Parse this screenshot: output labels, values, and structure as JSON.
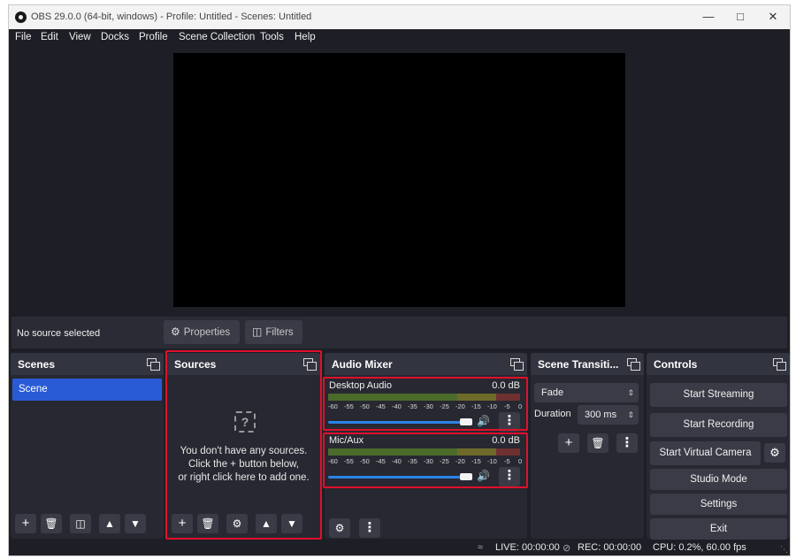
{
  "window": {
    "title": "OBS 29.0.0 (64-bit, windows) - Profile: Untitled - Scenes: Untitled"
  },
  "menu": [
    "File",
    "Edit",
    "View",
    "Docks",
    "Profile",
    "Scene Collection",
    "Tools",
    "Help"
  ],
  "context": {
    "no_source": "No source selected",
    "properties": "Properties",
    "filters": "Filters"
  },
  "scenes": {
    "title": "Scenes",
    "items": [
      "Scene"
    ]
  },
  "sources": {
    "title": "Sources",
    "empty_line1": "You don't have any sources.",
    "empty_line2": "Click the + button below,",
    "empty_line3": "or right click here to add one."
  },
  "audio_mixer": {
    "title": "Audio Mixer",
    "channels": [
      {
        "name": "Desktop Audio",
        "db": "0.0 dB",
        "volume": 1.0
      },
      {
        "name": "Mic/Aux",
        "db": "0.0 dB",
        "volume": 1.0
      }
    ],
    "scale": [
      "-60",
      "-55",
      "-50",
      "-45",
      "-40",
      "-35",
      "-30",
      "-25",
      "-20",
      "-15",
      "-10",
      "-5",
      "0"
    ]
  },
  "transitions": {
    "title": "Scene Transiti...",
    "selected": "Fade",
    "duration_label": "Duration",
    "duration_value": "300 ms"
  },
  "controls": {
    "title": "Controls",
    "start_streaming": "Start Streaming",
    "start_recording": "Start Recording",
    "start_virtual_camera": "Start Virtual Camera",
    "studio_mode": "Studio Mode",
    "settings": "Settings",
    "exit": "Exit"
  },
  "status": {
    "live": "LIVE: 00:00:00",
    "rec": "REC: 00:00:00",
    "cpu": "CPU: 0.2%, 60.00 fps"
  },
  "colors": {
    "accent": "#2a5bd7",
    "highlight": "#e0102c",
    "slider": "#2a84e6"
  }
}
